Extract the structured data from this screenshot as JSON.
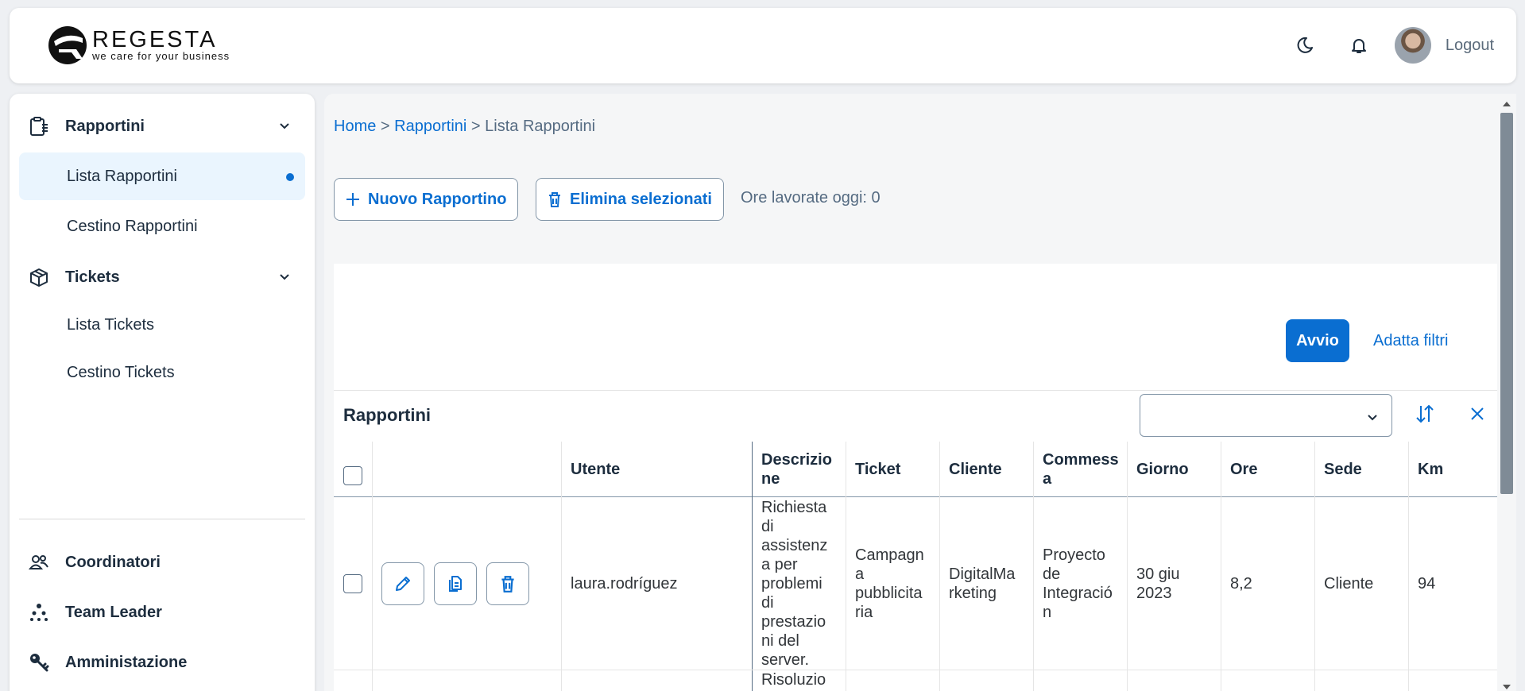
{
  "header": {
    "brand": "REGESTA",
    "tagline": "we care for your business",
    "logout": "Logout"
  },
  "sidebar": {
    "groups": [
      {
        "label": "Rapportini",
        "items": [
          {
            "label": "Lista Rapportini",
            "active": true
          },
          {
            "label": "Cestino Rapportini"
          }
        ]
      },
      {
        "label": "Tickets",
        "items": [
          {
            "label": "Lista Tickets"
          },
          {
            "label": "Cestino Tickets"
          }
        ]
      }
    ],
    "bottom": [
      {
        "label": "Coordinatori"
      },
      {
        "label": "Team Leader"
      },
      {
        "label": "Amministazione"
      }
    ]
  },
  "breadcrumb": {
    "home": "Home",
    "section": "Rapportini",
    "current": "Lista Rapportini",
    "sep": ">"
  },
  "toolbar": {
    "new_label": "Nuovo Rapportino",
    "delete_label": "Elimina selezionati",
    "hours_today": "Ore lavorate oggi: 0"
  },
  "filters": {
    "start": "Avvio",
    "adapt": "Adatta filtri"
  },
  "table": {
    "title": "Rapportini",
    "select_value": "",
    "columns": {
      "utente": "Utente",
      "descrizione": [
        "Descrizio",
        "ne"
      ],
      "ticket": "Ticket",
      "cliente": "Cliente",
      "commessa": [
        "Commess",
        "a"
      ],
      "giorno": "Giorno",
      "ore": "Ore",
      "sede": "Sede",
      "km": "Km"
    },
    "rows": [
      {
        "utente": "laura.rodríguez",
        "descrizione": [
          "Richiesta",
          "di",
          "assistenz",
          "a per",
          "problemi",
          "di",
          "prestazio",
          "ni del",
          "server."
        ],
        "ticket": [
          "Campagn",
          "a",
          "pubblicita",
          "ria"
        ],
        "cliente": [
          "DigitalMa",
          "rketing"
        ],
        "commessa": [
          "Proyecto",
          "de",
          "Integració",
          "n"
        ],
        "giorno": [
          "30 giu",
          "2023"
        ],
        "ore": "8,2",
        "sede": "Cliente",
        "km": "94"
      },
      {
        "descrizione": [
          "Risoluzio"
        ]
      }
    ]
  },
  "colors": {
    "accent": "#0a6ed1",
    "active_bg": "#eaf5fe",
    "text": "#1d2d3e"
  }
}
